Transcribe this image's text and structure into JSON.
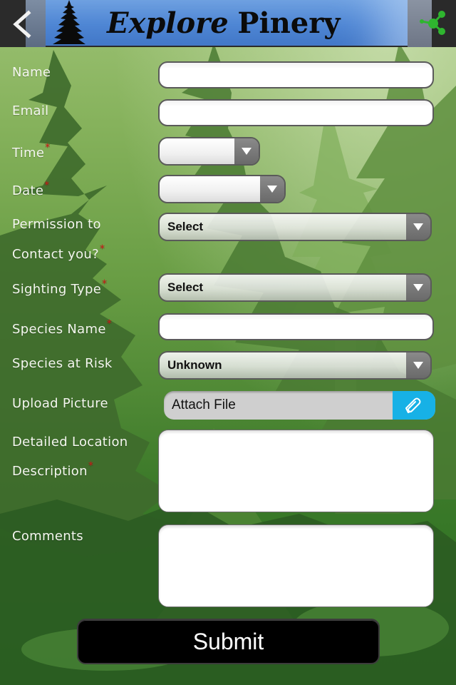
{
  "header": {
    "title_italic": "Explore",
    "title_regular": "Pinery",
    "back_icon": "chevron-left-icon",
    "share_icon": "share-icon",
    "logo_icon": "pine-tree-icon"
  },
  "colors": {
    "banner_blue": "#4f86d4",
    "share_green": "#2fb52f",
    "required_marker": "#d01616",
    "attach_button": "#17b1e6",
    "submit_bg": "#000000"
  },
  "form": {
    "required_marker": "*",
    "fields": {
      "name": {
        "label": "Name",
        "value": "",
        "placeholder": ""
      },
      "email": {
        "label": "Email",
        "value": "",
        "placeholder": ""
      },
      "time": {
        "label": "Time",
        "value": ""
      },
      "date": {
        "label": "Date",
        "value": ""
      },
      "permission": {
        "label_line1": "Permission to",
        "label_line2": "Contact you?",
        "value": "Select"
      },
      "sighting_type": {
        "label": "Sighting Type",
        "value": "Select"
      },
      "species_name": {
        "label": "Species Name",
        "value": "",
        "placeholder": ""
      },
      "species_at_risk": {
        "label": "Species at Risk",
        "value": "Unknown"
      },
      "upload_picture": {
        "label": "Upload Picture",
        "value": "Attach File",
        "icon": "paperclip-icon"
      },
      "location_description": {
        "label_line1": "Detailed Location",
        "label_line2": "Description",
        "value": ""
      },
      "comments": {
        "label": "Comments",
        "value": ""
      }
    },
    "submit_label": "Submit"
  }
}
